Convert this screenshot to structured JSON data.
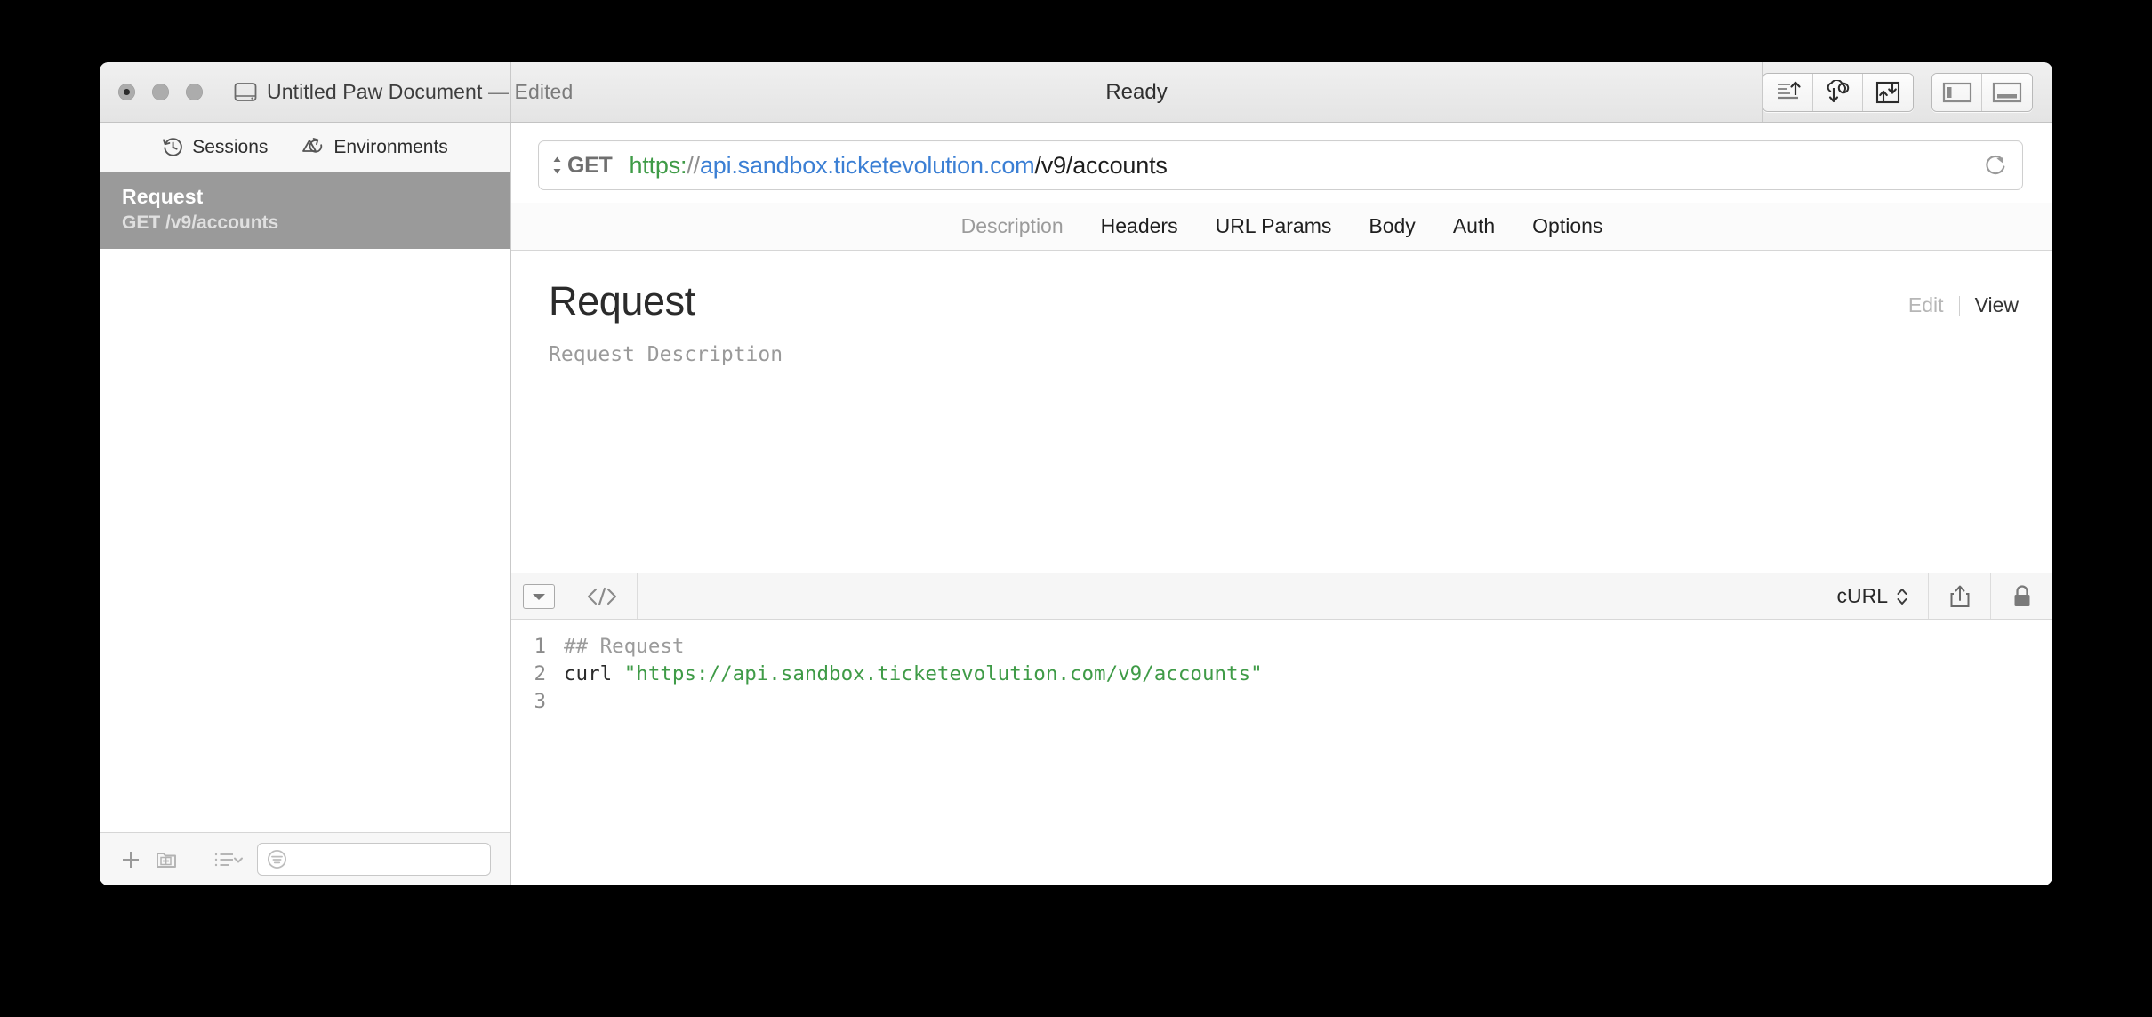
{
  "window": {
    "title": "Untitled Paw Document",
    "edited_suffix": "— Edited",
    "status": "Ready"
  },
  "titlebar": {
    "document_icon": "document-icon",
    "toolbar_buttons": [
      {
        "name": "send-request-button",
        "icon": "lines-up-arrow-icon"
      },
      {
        "name": "cloud-sync-button",
        "icon": "cloud-down-arrow-icon"
      },
      {
        "name": "import-export-button",
        "icon": "sync-box-icon"
      }
    ],
    "panel_toggles": [
      {
        "name": "toggle-left-sidebar-button",
        "icon": "left-panel-icon"
      },
      {
        "name": "toggle-bottom-panel-button",
        "icon": "bottom-panel-icon"
      }
    ]
  },
  "sidebar": {
    "tabs": [
      {
        "label": "Sessions",
        "icon": "clock-history-icon"
      },
      {
        "label": "Environments",
        "icon": "environments-icon"
      }
    ],
    "requests": [
      {
        "title": "Request",
        "subtitle": "GET /v9/accounts",
        "selected": true
      }
    ],
    "footer": {
      "add_label": "+",
      "new_folder_icon": "new-folder-icon",
      "list_options_icon": "list-chevron-icon",
      "filter_icon": "filter-circle-icon",
      "filter_placeholder": ""
    }
  },
  "urlbar": {
    "method": "GET",
    "url_scheme": "https:",
    "url_slashes": "//",
    "url_host": "api.sandbox.ticketevolution.com",
    "url_path": "/v9/accounts",
    "reload_icon": "reload-icon"
  },
  "request_tabs": [
    {
      "label": "Description",
      "active": true
    },
    {
      "label": "Headers",
      "active": false
    },
    {
      "label": "URL Params",
      "active": false
    },
    {
      "label": "Body",
      "active": false
    },
    {
      "label": "Auth",
      "active": false
    },
    {
      "label": "Options",
      "active": false
    }
  ],
  "description": {
    "title": "Request",
    "placeholder": "Request Description",
    "edit_label": "Edit",
    "view_label": "View"
  },
  "code_panel": {
    "collapse_icon": "chevron-down-icon",
    "code_icon": "code-brackets-icon",
    "language": "cURL",
    "language_chevron": "chevron-updown-icon",
    "share_icon": "share-icon",
    "lock_icon": "lock-icon",
    "gutter": [
      "1",
      "2",
      "3"
    ],
    "lines": [
      {
        "comment": "## Request"
      },
      {
        "command": "curl ",
        "string": "\"https://api.sandbox.ticketevolution.com/v9/accounts\""
      },
      {
        "empty": ""
      }
    ]
  },
  "colors": {
    "accent_green": "#3f9b47",
    "accent_blue": "#3b7fd4",
    "selected_row": "#9a9a9a",
    "toolbar_bg": "#f6f6f6"
  }
}
